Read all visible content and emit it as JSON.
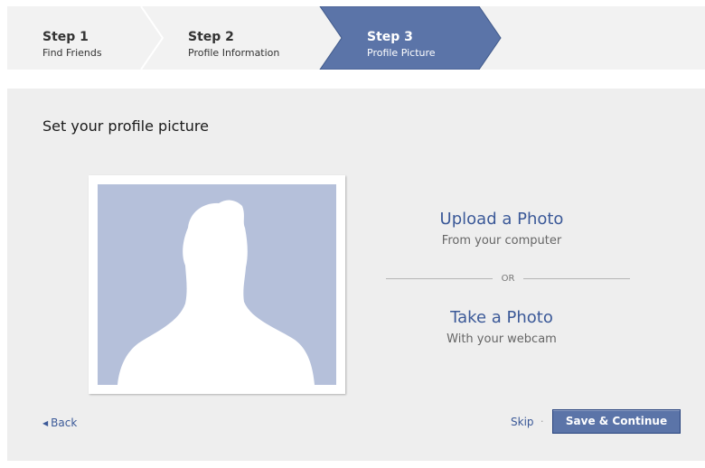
{
  "steps": [
    {
      "number": "Step 1",
      "label": "Find Friends"
    },
    {
      "number": "Step 2",
      "label": "Profile Information"
    },
    {
      "number": "Step 3",
      "label": "Profile Picture"
    }
  ],
  "active_step": "Step 3",
  "page": {
    "title": "Set your profile picture"
  },
  "upload": {
    "title": "Upload a Photo",
    "subtitle": "From your computer"
  },
  "divider": {
    "label": "OR"
  },
  "webcam": {
    "title": "Take a Photo",
    "subtitle": "With your webcam"
  },
  "footer": {
    "back_label": "Back",
    "skip_label": "Skip",
    "separator": "·",
    "save_label": "Save & Continue"
  },
  "icons": {
    "back": "left-triangle-icon",
    "avatar": "default-profile-silhouette"
  },
  "colors": {
    "accent": "#3b5998",
    "active_step_bg": "#5b74a8",
    "avatar_bg": "#b5c0da",
    "panel_bg": "#eeeeee"
  }
}
